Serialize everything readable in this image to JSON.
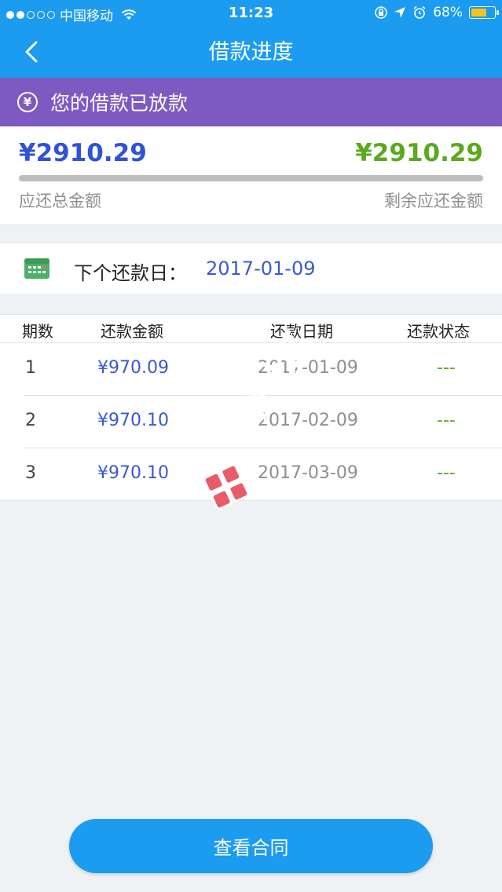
{
  "status_bar": {
    "carrier": "中国移动",
    "time": "11:23",
    "battery_percent": "68%",
    "battery_level": 0.68,
    "signal_bars_filled": 2,
    "signal_bars_total": 5
  },
  "nav": {
    "title": "借款进度",
    "back_icon": "chevron-left-icon"
  },
  "banner": {
    "icon_symbol": "¥",
    "text": "您的借款已放款"
  },
  "amounts": {
    "total": "¥2910.29",
    "total_label": "应还总金额",
    "remaining": "¥2910.29",
    "remaining_label": "剩余应还金额",
    "repaid_fraction": 0.0
  },
  "next_payment": {
    "label": "下个还款日：",
    "date": "2017-01-09"
  },
  "schedule": {
    "headers": [
      "期数",
      "还款金额",
      "还款日期",
      "还款状态"
    ],
    "rows": [
      {
        "period": "1",
        "amount": "¥970.09",
        "date": "2017-01-09",
        "status": "---"
      },
      {
        "period": "2",
        "amount": "¥970.10",
        "date": "2017-02-09",
        "status": "---"
      },
      {
        "period": "3",
        "amount": "¥970.10",
        "date": "2017-03-09",
        "status": "---"
      }
    ]
  },
  "watermark": {
    "text": "卡农社区"
  },
  "contract_button": {
    "label": "查看合同"
  },
  "colors": {
    "primary_blue": "#1b9cf0",
    "banner_purple": "#7d5ac1",
    "amount_blue": "#2f52d8",
    "amount_green": "#5aa91f"
  }
}
